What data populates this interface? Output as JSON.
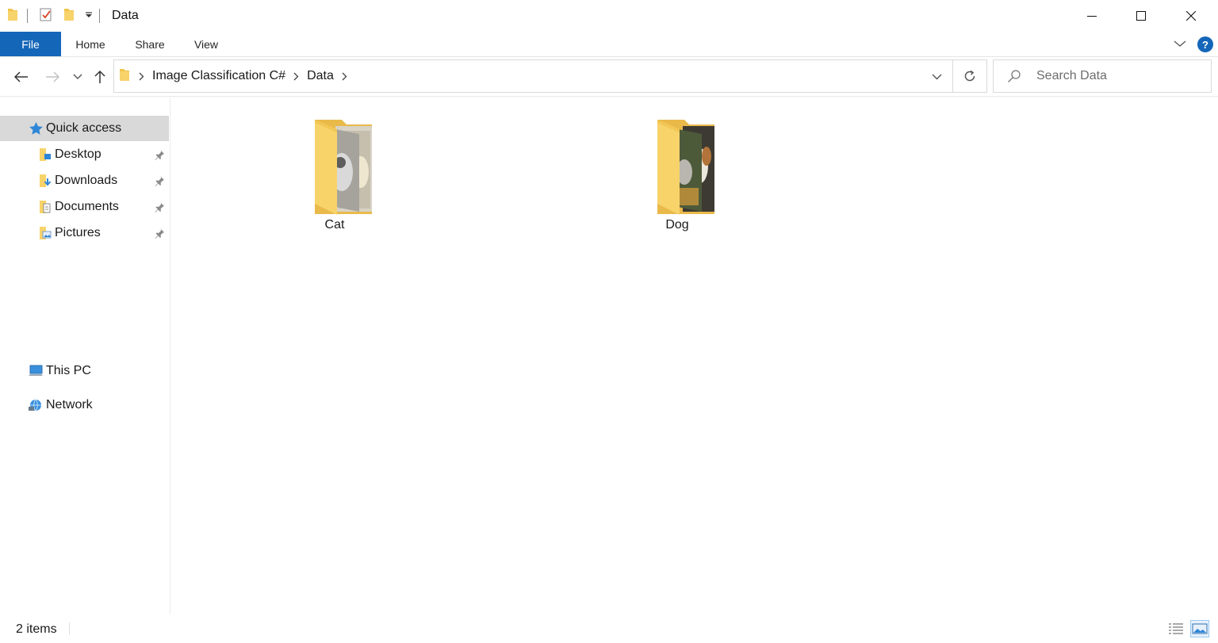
{
  "window": {
    "title": "Data"
  },
  "ribbon": {
    "tabs": [
      {
        "label": "File"
      },
      {
        "label": "Home"
      },
      {
        "label": "Share"
      },
      {
        "label": "View"
      }
    ],
    "help_label": "?"
  },
  "address": {
    "crumbs": [
      "Image Classification C#",
      "Data"
    ]
  },
  "search": {
    "placeholder": "Search Data"
  },
  "sidebar": {
    "quick_access": "Quick access",
    "pinned": [
      {
        "label": "Desktop",
        "icon": "desktop-folder-icon"
      },
      {
        "label": "Downloads",
        "icon": "downloads-folder-icon"
      },
      {
        "label": "Documents",
        "icon": "documents-folder-icon"
      },
      {
        "label": "Pictures",
        "icon": "pictures-folder-icon"
      }
    ],
    "this_pc": "This PC",
    "network": "Network"
  },
  "items": [
    {
      "name": "Cat",
      "icon": "cat-folder-icon"
    },
    {
      "name": "Dog",
      "icon": "dog-folder-icon"
    }
  ],
  "status": {
    "item_count": "2 items"
  },
  "colors": {
    "accent": "#1466b8",
    "folder": "#f7d36a",
    "selection": "#d9d9d9"
  }
}
